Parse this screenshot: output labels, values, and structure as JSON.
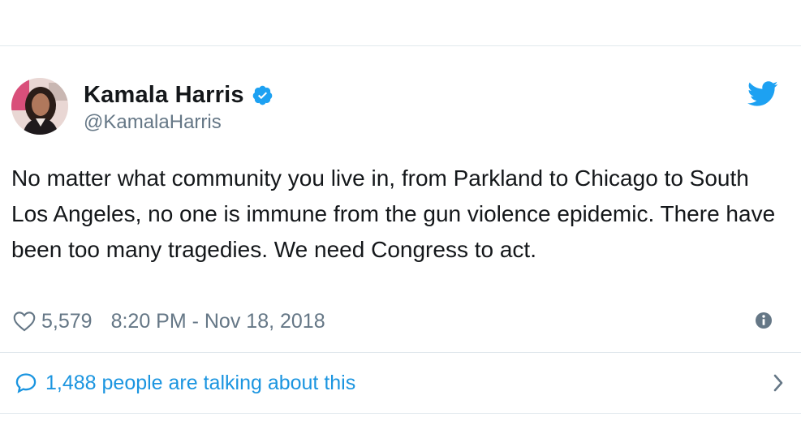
{
  "tweet": {
    "author": {
      "display_name": "Kamala Harris",
      "handle": "@KamalaHarris",
      "verified": true,
      "avatar": "profile-photo"
    },
    "text": "No matter what community you live in, from Parkland to Chicago to South Los Angeles, no one is immune from the gun violence epidemic. There have been too many tragedies. We need Congress to act.",
    "likes": "5,579",
    "timestamp": "8:20 PM - Nov 18, 2018",
    "conversation_label": "1,488 people are talking about this"
  },
  "icons": {
    "brand": "twitter-bird-icon",
    "verified": "verified-badge-icon",
    "like": "heart-icon",
    "info": "info-icon",
    "reply": "speech-bubble-icon",
    "chevron": "chevron-right-icon"
  },
  "colors": {
    "brand_blue": "#1da1f2",
    "link_blue": "#1b95e0",
    "text_primary": "#14171a",
    "text_secondary": "#657786",
    "divider": "#e1e8ed"
  }
}
